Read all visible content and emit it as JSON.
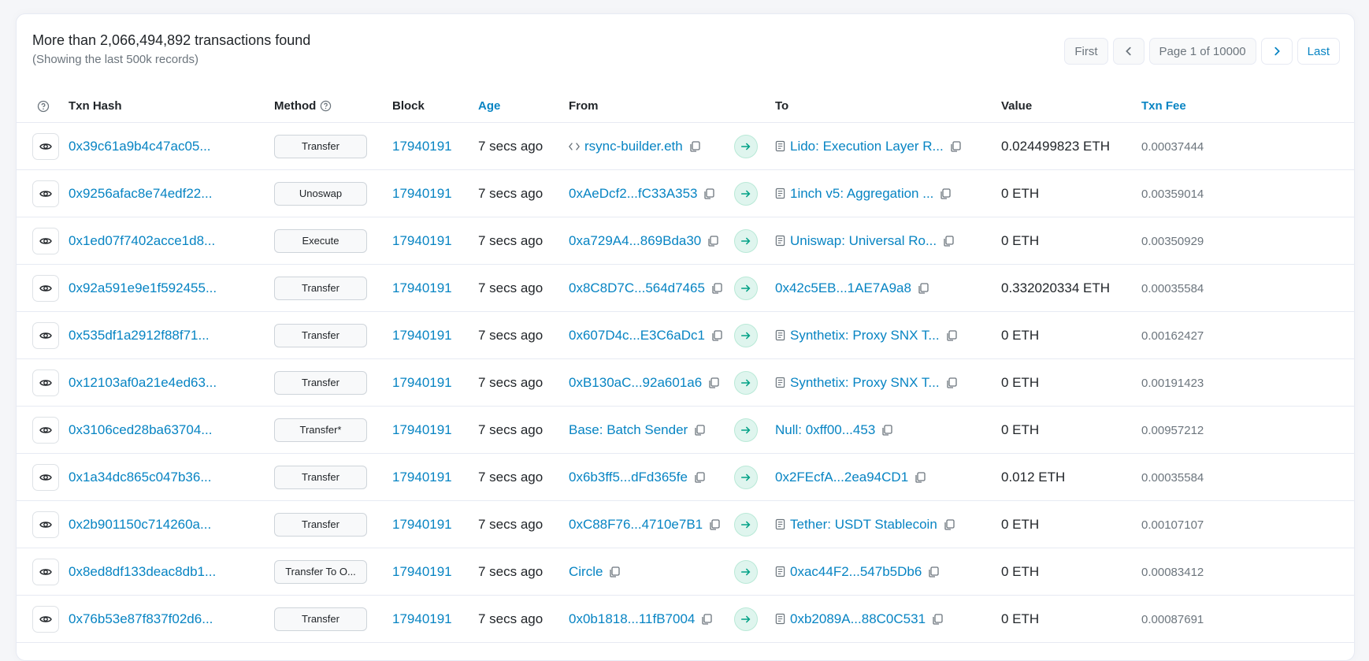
{
  "summary": {
    "title": "More than 2,066,494,892 transactions found",
    "subtitle": "(Showing the last 500k records)"
  },
  "pager": {
    "first": "First",
    "page": "Page 1 of 10000",
    "last": "Last"
  },
  "headers": {
    "txn_hash": "Txn Hash",
    "method": "Method",
    "block": "Block",
    "age": "Age",
    "from": "From",
    "to": "To",
    "value": "Value",
    "txn_fee": "Txn Fee"
  },
  "colors": {
    "link": "#0784c3",
    "arrow_bg": "#dff5ee",
    "arrow_fg": "#00a186"
  },
  "rows": [
    {
      "hash": "0x39c61a9b4c47ac05...",
      "method": "Transfer",
      "block": "17940191",
      "age": "7 secs ago",
      "from": "rsync-builder.eth",
      "from_icon": "code-icon",
      "to": "Lido: Execution Layer R...",
      "to_icon": "contract-icon",
      "value": "0.024499823 ETH",
      "fee": "0.00037444"
    },
    {
      "hash": "0x9256afac8e74edf22...",
      "method": "Unoswap",
      "block": "17940191",
      "age": "7 secs ago",
      "from": "0xAeDcf2...fC33A353",
      "from_icon": "",
      "to": "1inch v5: Aggregation ...",
      "to_icon": "contract-icon",
      "value": "0 ETH",
      "fee": "0.00359014"
    },
    {
      "hash": "0x1ed07f7402acce1d8...",
      "method": "Execute",
      "block": "17940191",
      "age": "7 secs ago",
      "from": "0xa729A4...869Bda30",
      "from_icon": "",
      "to": "Uniswap: Universal Ro...",
      "to_icon": "contract-icon",
      "value": "0 ETH",
      "fee": "0.00350929"
    },
    {
      "hash": "0x92a591e9e1f592455...",
      "method": "Transfer",
      "block": "17940191",
      "age": "7 secs ago",
      "from": "0x8C8D7C...564d7465",
      "from_icon": "",
      "to": "0x42c5EB...1AE7A9a8",
      "to_icon": "",
      "value": "0.332020334 ETH",
      "fee": "0.00035584"
    },
    {
      "hash": "0x535df1a2912f88f71...",
      "method": "Transfer",
      "block": "17940191",
      "age": "7 secs ago",
      "from": "0x607D4c...E3C6aDc1",
      "from_icon": "",
      "to": "Synthetix: Proxy SNX T...",
      "to_icon": "contract-icon",
      "value": "0 ETH",
      "fee": "0.00162427"
    },
    {
      "hash": "0x12103af0a21e4ed63...",
      "method": "Transfer",
      "block": "17940191",
      "age": "7 secs ago",
      "from": "0xB130aC...92a601a6",
      "from_icon": "",
      "to": "Synthetix: Proxy SNX T...",
      "to_icon": "contract-icon",
      "value": "0 ETH",
      "fee": "0.00191423"
    },
    {
      "hash": "0x3106ced28ba63704...",
      "method": "Transfer*",
      "block": "17940191",
      "age": "7 secs ago",
      "from": "Base: Batch Sender",
      "from_icon": "",
      "to": "Null: 0xff00...453",
      "to_icon": "",
      "value": "0 ETH",
      "fee": "0.00957212"
    },
    {
      "hash": "0x1a34dc865c047b36...",
      "method": "Transfer",
      "block": "17940191",
      "age": "7 secs ago",
      "from": "0x6b3ff5...dFd365fe",
      "from_icon": "",
      "to": "0x2FEcfA...2ea94CD1",
      "to_icon": "",
      "value": "0.012 ETH",
      "fee": "0.00035584"
    },
    {
      "hash": "0x2b901150c714260a...",
      "method": "Transfer",
      "block": "17940191",
      "age": "7 secs ago",
      "from": "0xC88F76...4710e7B1",
      "from_icon": "",
      "to": "Tether: USDT Stablecoin",
      "to_icon": "contract-icon",
      "value": "0 ETH",
      "fee": "0.00107107"
    },
    {
      "hash": "0x8ed8df133deac8db1...",
      "method": "Transfer To O...",
      "block": "17940191",
      "age": "7 secs ago",
      "from": "Circle",
      "from_icon": "",
      "to": "0xac44F2...547b5Db6",
      "to_icon": "contract-icon",
      "value": "0 ETH",
      "fee": "0.00083412"
    },
    {
      "hash": "0x76b53e87f837f02d6...",
      "method": "Transfer",
      "block": "17940191",
      "age": "7 secs ago",
      "from": "0x0b1818...11fB7004",
      "from_icon": "",
      "to": "0xb2089A...88C0C531",
      "to_icon": "contract-icon",
      "value": "0 ETH",
      "fee": "0.00087691"
    }
  ]
}
